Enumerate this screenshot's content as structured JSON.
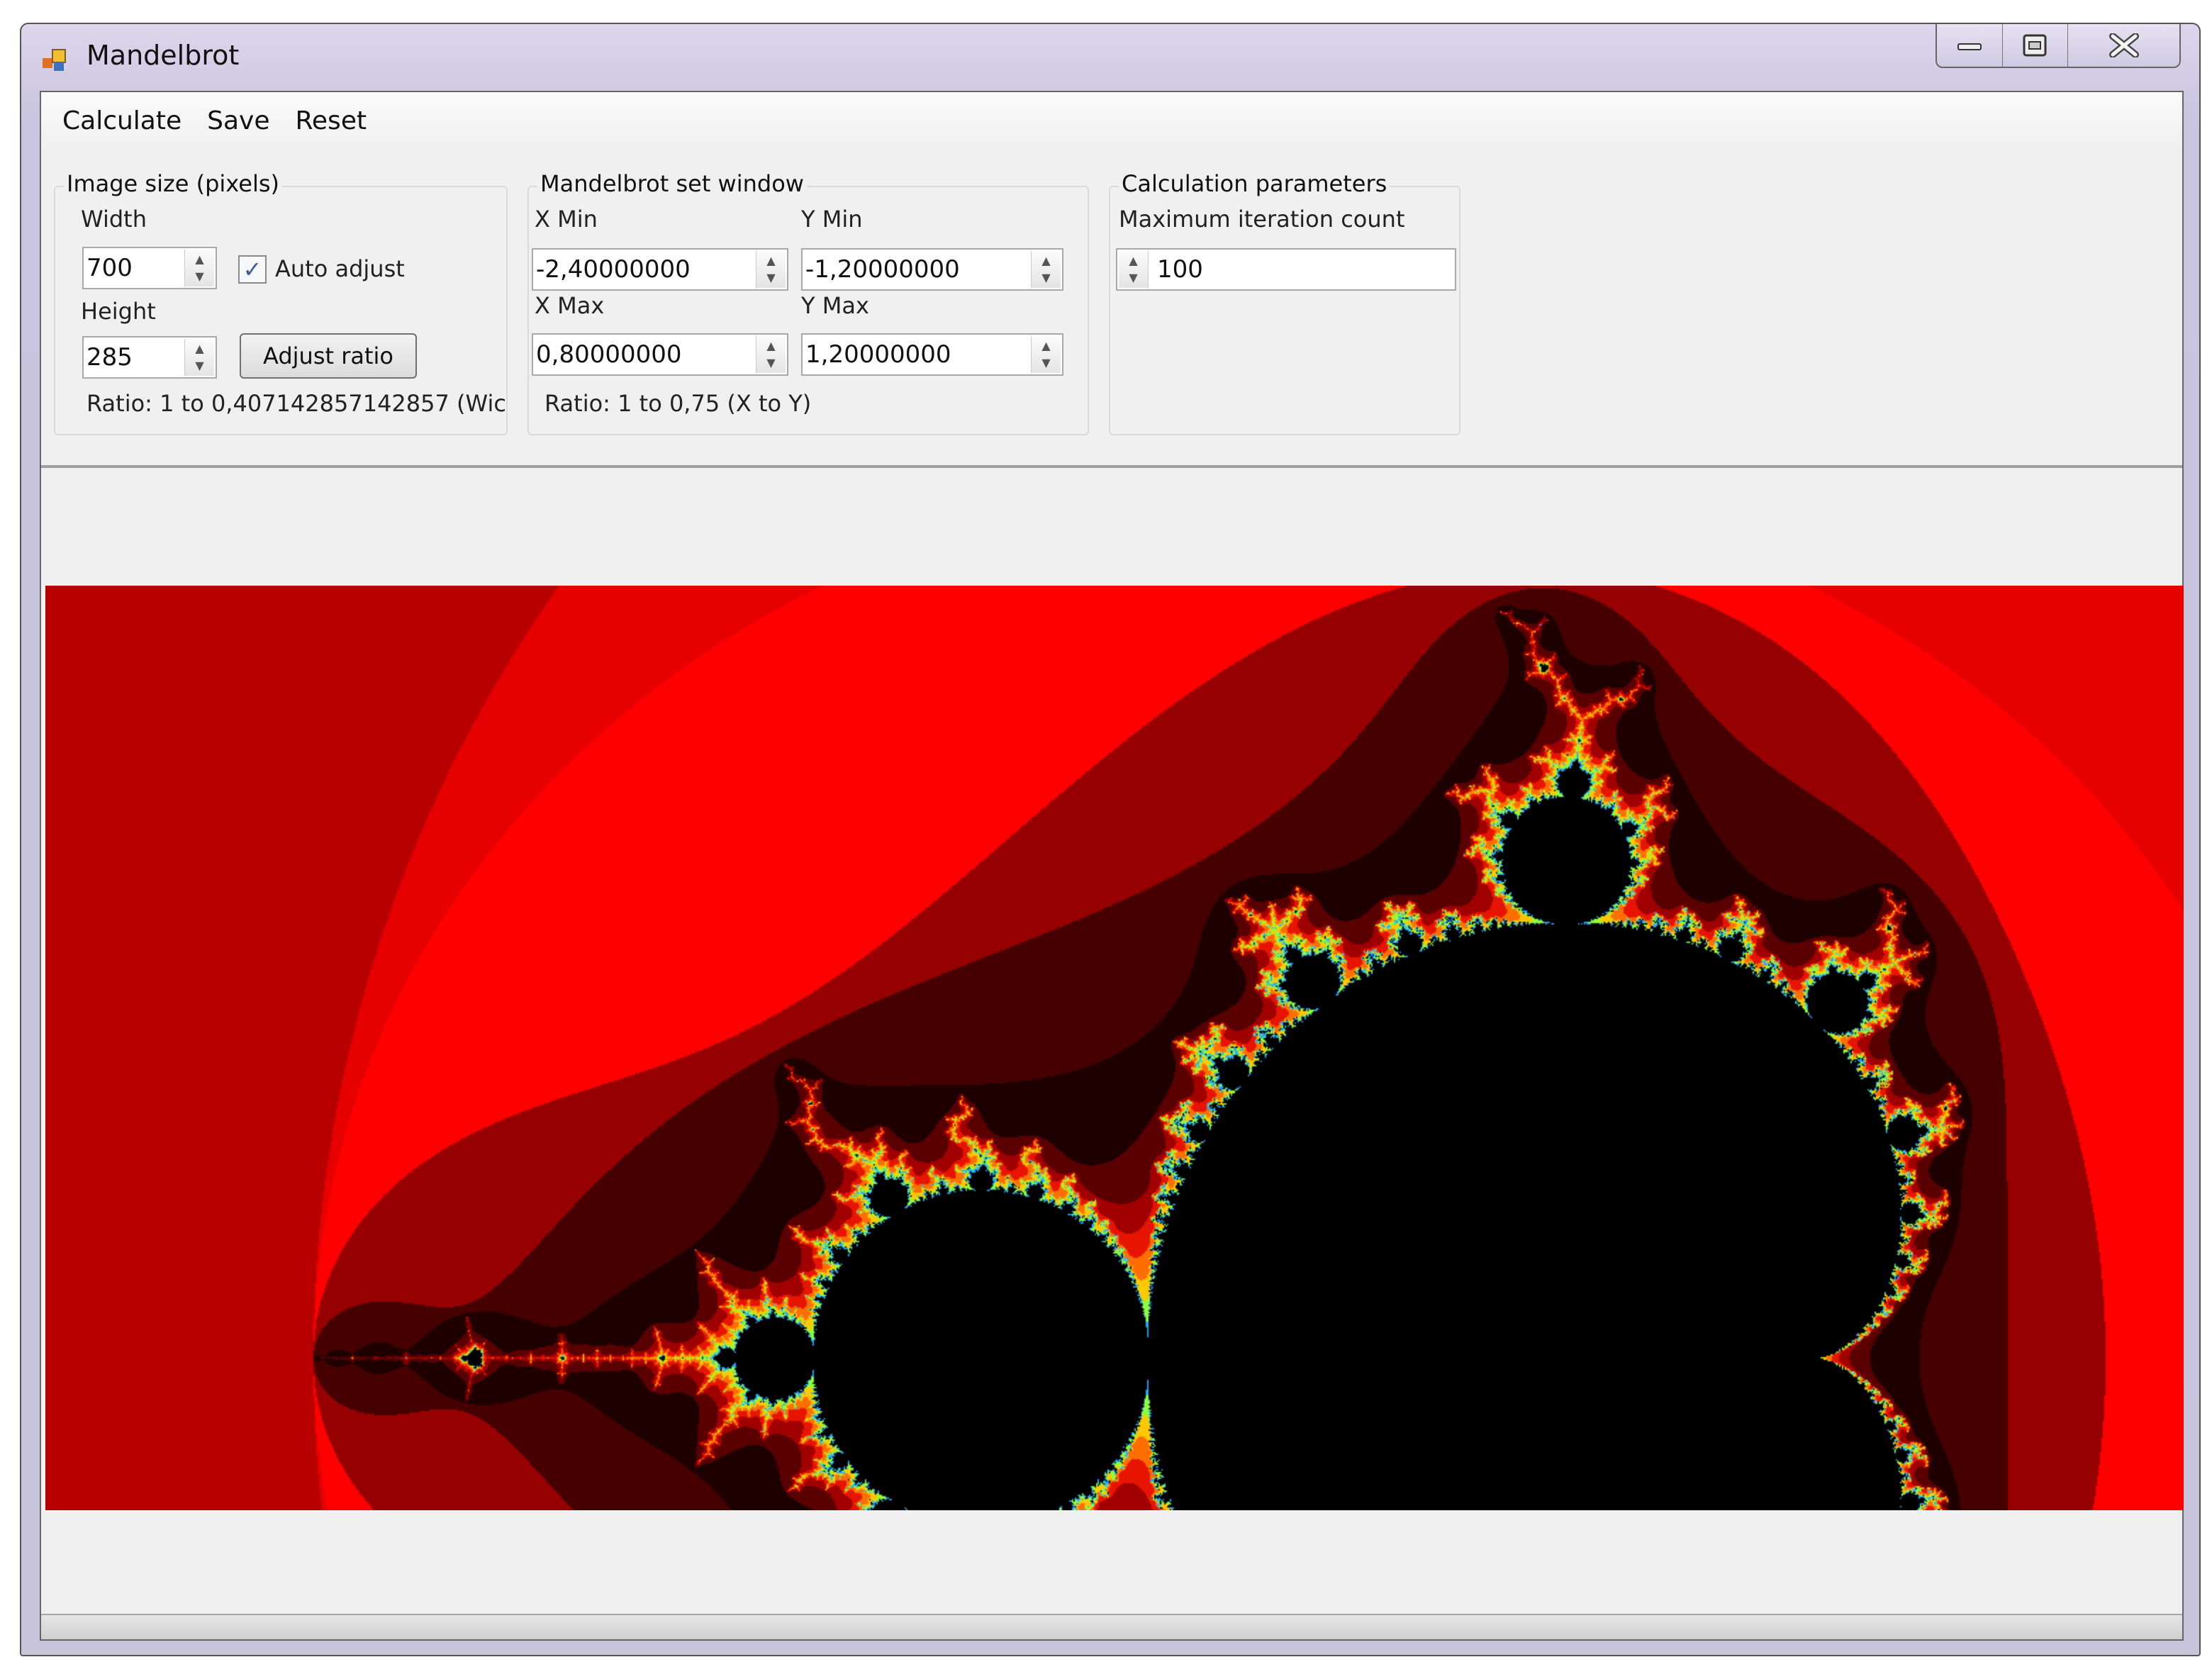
{
  "window": {
    "title": "Mandelbrot",
    "icon": "app-icon",
    "controls": [
      "minimize-icon",
      "maximize-icon",
      "close-icon"
    ]
  },
  "menu": {
    "items": [
      "Calculate",
      "Save",
      "Reset"
    ]
  },
  "image_size": {
    "title": "Image size (pixels)",
    "width_label": "Width",
    "width_value": "700",
    "auto_adjust_label": "Auto adjust",
    "auto_adjust_checked": true,
    "height_label": "Height",
    "height_value": "285",
    "adjust_button": "Adjust ratio",
    "ratio_text": "Ratio: 1 to 0,407142857142857 (Wic"
  },
  "set_window": {
    "title": "Mandelbrot set window",
    "xmin_label": "X Min",
    "xmin_value": "-2,40000000",
    "ymin_label": "Y Min",
    "ymin_value": "-1,20000000",
    "xmax_label": "X Max",
    "xmax_value": "0,80000000",
    "ymax_label": "Y Max",
    "ymax_value": "1,20000000",
    "ratio_text": "Ratio: 1 to 0,75 (X to Y)"
  },
  "calc_params": {
    "title": "Calculation parameters",
    "max_iter_label": "Maximum iteration count",
    "max_iter_value": "100"
  },
  "colors": {
    "outer": "#b80000",
    "band": "#ff0000",
    "inside": "#000000"
  }
}
